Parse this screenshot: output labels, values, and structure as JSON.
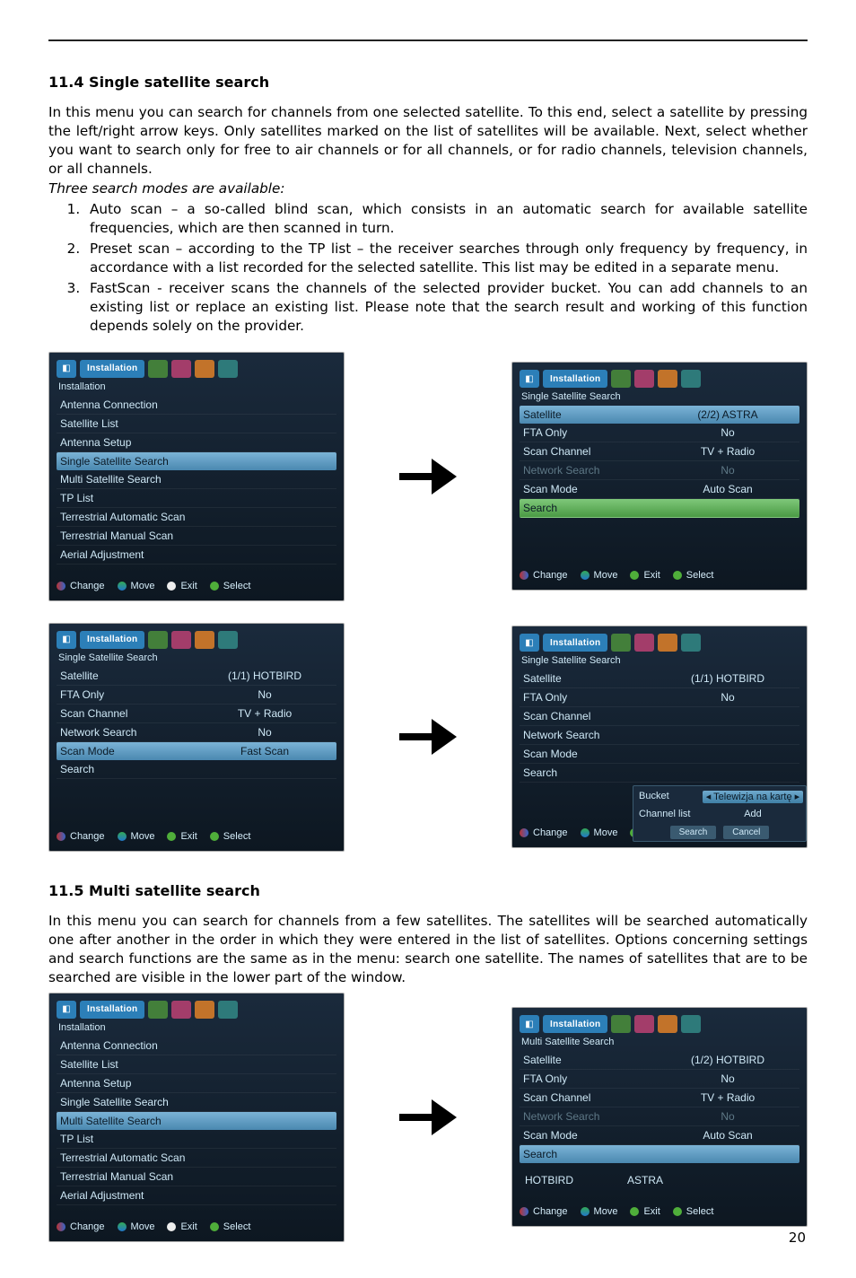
{
  "page_number": "20",
  "section_114": {
    "heading": "11.4 Single satellite search",
    "p1": "In this menu you can search for channels from one selected satellite. To this end, select a satellite by pressing the left/right arrow keys.  Only satellites marked on the list of satellites will be available. Next, select whether you want to search only for free to air channels or for all channels, or for radio channels, television channels, or all channels.",
    "modes_intro": "Three search modes are available:",
    "modes": [
      "Auto scan – a so-called blind scan, which consists in an automatic search for available satellite frequencies, which are then scanned in turn.",
      "Preset scan – according to the TP list – the receiver searches through only frequency by frequency, in accordance with a list recorded for the selected satellite. This list may be edited in a separate menu.",
      "FastScan - receiver scans the channels of the selected provider bucket. You can add channels to an existing list or replace an existing list. Please note that the search result and working of this function depends solely on the provider."
    ]
  },
  "section_115": {
    "heading": "11.5 Multi satellite search",
    "p1": "In this menu you can search for channels from a few satellites. The satellites will be searched automatically one after another in the order in which they were entered in the list of satellites. Options concerning settings and search functions are the same as in the menu: search one satellite. The names of satellites that are to be searched are visible in the lower part of the window."
  },
  "ui": {
    "tab_installation": "Installation",
    "foot": {
      "change": "Change",
      "move": "Move",
      "exit": "Exit",
      "select": "Select"
    },
    "screen_A": {
      "title": "Installation",
      "items": [
        "Antenna Connection",
        "Satellite List",
        "Antenna Setup",
        "Single Satellite Search",
        "Multi Satellite Search",
        "TP List",
        "Terrestrial Automatic Scan",
        "Terrestrial Manual Scan",
        "Aerial Adjustment"
      ],
      "highlight_index": 3
    },
    "screen_B": {
      "title": "Single Satellite Search",
      "rows": [
        {
          "label": "Satellite",
          "value": "(2/2) ASTRA",
          "hl": true
        },
        {
          "label": "FTA Only",
          "value": "No"
        },
        {
          "label": "Scan Channel",
          "value": "TV + Radio"
        },
        {
          "label": "Network Search",
          "value": "No",
          "dim": true
        },
        {
          "label": "Scan Mode",
          "value": "Auto Scan"
        },
        {
          "label": "Search",
          "value": "",
          "hlgreen": true
        }
      ]
    },
    "screen_C": {
      "title": "Single Satellite Search",
      "rows": [
        {
          "label": "Satellite",
          "value": "(1/1) HOTBIRD"
        },
        {
          "label": "FTA Only",
          "value": "No"
        },
        {
          "label": "Scan Channel",
          "value": "TV + Radio"
        },
        {
          "label": "Network Search",
          "value": "No"
        },
        {
          "label": "Scan Mode",
          "value": "Fast Scan",
          "hl": true
        },
        {
          "label": "Search",
          "value": ""
        }
      ]
    },
    "screen_D": {
      "title": "Single Satellite Search",
      "rows": [
        {
          "label": "Satellite",
          "value": "(1/1) HOTBIRD"
        },
        {
          "label": "FTA Only",
          "value": "No"
        },
        {
          "label": "Scan Channel",
          "value": ""
        },
        {
          "label": "Network Search",
          "value": ""
        },
        {
          "label": "Scan Mode",
          "value": ""
        },
        {
          "label": "Search",
          "value": ""
        }
      ],
      "popup": {
        "bucket_label": "Bucket",
        "bucket_value": "Telewizja na kartę",
        "channel_list_label": "Channel list",
        "channel_list_value": "Add",
        "btn_search": "Search",
        "btn_cancel": "Cancel"
      }
    },
    "screen_E": {
      "title": "Installation",
      "items": [
        "Antenna Connection",
        "Satellite List",
        "Antenna Setup",
        "Single Satellite Search",
        "Multi Satellite Search",
        "TP List",
        "Terrestrial Automatic Scan",
        "Terrestrial Manual Scan",
        "Aerial Adjustment"
      ],
      "highlight_index": 4
    },
    "screen_F": {
      "title": "Multi Satellite Search",
      "rows": [
        {
          "label": "Satellite",
          "value": "(1/2) HOTBIRD"
        },
        {
          "label": "FTA Only",
          "value": "No"
        },
        {
          "label": "Scan Channel",
          "value": "TV + Radio"
        },
        {
          "label": "Network Search",
          "value": "No",
          "dim": true
        },
        {
          "label": "Scan Mode",
          "value": "Auto Scan"
        },
        {
          "label": "Search",
          "value": "",
          "hl": true
        }
      ],
      "sats": [
        "HOTBIRD",
        "ASTRA"
      ]
    }
  }
}
